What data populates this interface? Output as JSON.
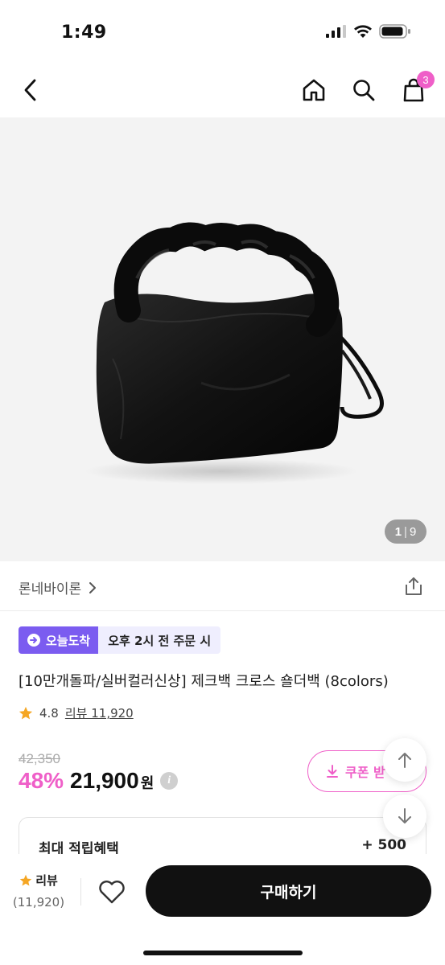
{
  "status_bar": {
    "time": "1:49"
  },
  "nav": {
    "cart_count": "3"
  },
  "image": {
    "current": "1",
    "separator": "|",
    "total": "9"
  },
  "brand": {
    "name": "론네바이론"
  },
  "delivery": {
    "tag": "오늘도착",
    "time": "오후 2시 전 주문 시"
  },
  "product": {
    "title": "[10만개돌파/실버컬러신상] 제크백 크로스 숄더백 (8colors)",
    "rating": "4.8",
    "review_link": "리뷰 11,920",
    "original_price": "42,350",
    "discount": "48%",
    "sale_price": "21,900",
    "currency": "원"
  },
  "coupon": {
    "label": "쿠폰 받"
  },
  "benefit": {
    "label": "최대 적립혜택",
    "value": "+ 500"
  },
  "bottom": {
    "review_label": "리뷰",
    "review_count": "(11,920)",
    "buy_label": "구매하기"
  },
  "colors": {
    "accent_pink": "#ef5fc8",
    "delivery_purple": "#7b5cf0",
    "star": "#f5a623"
  }
}
